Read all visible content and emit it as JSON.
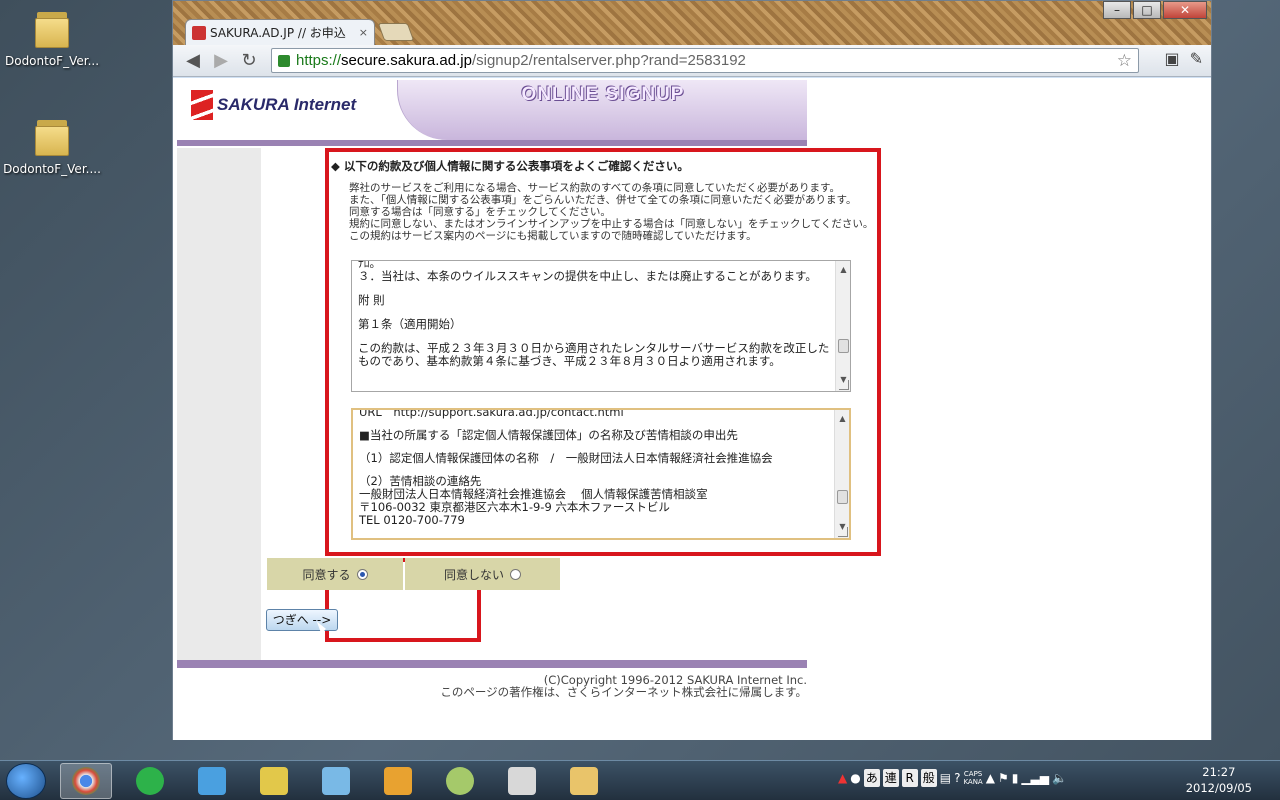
{
  "desktop": {
    "icons": [
      {
        "label": "DodontoF_Ver...",
        "icon": "folder-icon"
      },
      {
        "label": "DodontoF_Ver....",
        "icon": "folder-icon"
      }
    ]
  },
  "window": {
    "controls": {
      "minimize": "–",
      "maximize": "□",
      "close": "✕"
    },
    "tab": {
      "title": "SAKURA.AD.JP // お申込",
      "close": "×"
    },
    "toolbar": {
      "back": "◀",
      "forward": "▶",
      "reload": "↻"
    },
    "address": {
      "https": "https://",
      "host": "secure.sakura.ad.jp",
      "path": "/signup2/rentalserver.php?rand=2583192"
    }
  },
  "page": {
    "logo": "SAKURA Internet",
    "banner": "ONLINE SIGNUP",
    "heading": "◆ 以下の約款及び個人情報に関する公表事項をよくご確認ください。",
    "intro": [
      "弊社のサービスをご利用になる場合、サービス約款のすべての条項に同意していただく必要があります。",
      "また、「個人情報に関する公表事項」をごらんいただき、併せて全ての条項に同意いただく必要があります。",
      "同意する場合は「同意する」をチェックしてください。",
      "規約に同意しない、またはオンラインサインアップを中止する場合は「同意しない」をチェックしてください。",
      "この規約はサービス案内のページにも掲載していますので随時確認していただけます。"
    ],
    "terms_box": [
      "ﾅﾛ。",
      "３．当社は、本条のウイルススキャンの提供を中止し、または廃止することがあります。",
      "附 則",
      "第１条（適用開始）",
      "この約款は、平成２３年３月３０日から適用されたレンタルサーバサービス約款を改正したものであり、基本約款第４条に基づき、平成２３年８月３０日より適用されます。"
    ],
    "privacy_box": [
      "URL　http://support.sakura.ad.jp/contact.html",
      "■当社の所属する「認定個人情報保護団体」の名称及び苦情相談の申出先",
      "（1）認定個人情報保護団体の名称　/　一般財団法人日本情報経済社会推進協会",
      "（2）苦情相談の連絡先",
      "一般財団法人日本情報経済社会推進協会　 個人情報保護苦情相談室",
      "〒106-0032 東京都港区六本木1-9-9 六本木ファーストビル",
      "TEL 0120-700-779"
    ],
    "agree": {
      "yes_label": "同意する",
      "no_label": "同意しない",
      "selected": "yes"
    },
    "next_button": "つぎへ -->",
    "copyright": "(C)Copyright 1996-2012 SAKURA Internet Inc.",
    "copyright_note": "このページの著作権は、さくらインターネット株式会社に帰属します。"
  },
  "taskbar": {
    "apps": [
      {
        "icon": "chrome-icon",
        "active": true,
        "color": "#d94b3a"
      },
      {
        "icon": "green-app-icon",
        "color": "#2db24a"
      },
      {
        "icon": "ffftp-icon",
        "color": "#4aa0e0"
      },
      {
        "icon": "text-editor-icon",
        "color": "#e2c84a"
      },
      {
        "icon": "pen-icon",
        "color": "#79b9e6"
      },
      {
        "icon": "notify-icon",
        "color": "#e8a230"
      },
      {
        "icon": "globe-icon",
        "color": "#a5c96a"
      },
      {
        "icon": "notepad-icon",
        "color": "#d8d8d8"
      },
      {
        "icon": "explorer-icon",
        "color": "#e9c46a"
      }
    ],
    "tray": {
      "ime": [
        "あ",
        "連",
        "R",
        "般"
      ],
      "caps": "CAPS",
      "kana": "KANA"
    },
    "clock": {
      "time": "21:27",
      "date": "2012/09/05"
    }
  }
}
